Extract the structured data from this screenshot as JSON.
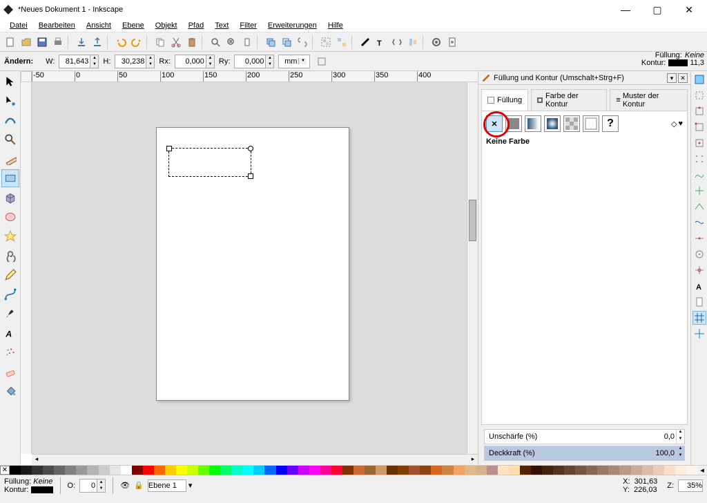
{
  "title": "*Neues Dokument 1 - Inkscape",
  "menus": [
    "Datei",
    "Bearbeiten",
    "Ansicht",
    "Ebene",
    "Objekt",
    "Pfad",
    "Text",
    "Filter",
    "Erweiterungen",
    "Hilfe"
  ],
  "optbar": {
    "label": "Ändern:",
    "W_label": "W:",
    "W": "81,643",
    "H_label": "H:",
    "H": "30,238",
    "Rx_label": "Rx:",
    "Rx": "0,000",
    "Ry_label": "Ry:",
    "Ry": "0,000",
    "unit": "mm"
  },
  "fillkontur_top": {
    "fill_label": "Füllung:",
    "fill_value": "Keine",
    "kontur_label": "Kontur:",
    "kontur_value": "11,3"
  },
  "panel": {
    "title": "Füllung und Kontur (Umschalt+Strg+F)",
    "tab_fill": "Füllung",
    "tab_stroke": "Farbe der Kontur",
    "tab_pattern": "Muster der Kontur",
    "nofill": "Keine Farbe",
    "blur_label": "Unschärfe (%)",
    "blur_value": "0,0",
    "opacity_label": "Deckkraft (%)",
    "opacity_value": "100,0"
  },
  "status": {
    "fill_label": "Füllung:",
    "fill_value": "Keine",
    "kontur_label": "Kontur:",
    "O_label": "O:",
    "O_value": "0",
    "layer_label": "Ebene 1",
    "x_label": "X:",
    "x_value": "301,63",
    "y_label": "Y:",
    "y_value": "226,03",
    "z_label": "Z:",
    "z_value": "35%"
  },
  "ruler_ticks": [
    "-50",
    "0",
    "50",
    "100",
    "150",
    "200",
    "250",
    "300",
    "350",
    "400"
  ],
  "palette": [
    "#000000",
    "#1a1a1a",
    "#333333",
    "#4d4d4d",
    "#666666",
    "#808080",
    "#999999",
    "#b3b3b3",
    "#cccccc",
    "#e6e6e6",
    "#ffffff",
    "#800000",
    "#ff0000",
    "#ff6600",
    "#ffcc00",
    "#ffff00",
    "#ccff00",
    "#66ff00",
    "#00ff00",
    "#00ff66",
    "#00ffcc",
    "#00ffff",
    "#00ccff",
    "#0066ff",
    "#0000ff",
    "#6600ff",
    "#cc00ff",
    "#ff00ff",
    "#ff0099",
    "#ff0033",
    "#803300",
    "#cc6633",
    "#996633",
    "#cc9966",
    "#663300",
    "#804000",
    "#a0522d",
    "#8b4513",
    "#d2691e",
    "#cd853f",
    "#f4a460",
    "#deb887",
    "#d2b48c",
    "#bc8f8f",
    "#ffe4c4",
    "#ffdead",
    "#552200",
    "#331100",
    "#442211",
    "#553322",
    "#664433",
    "#775544",
    "#886655",
    "#997766",
    "#aa8877",
    "#bb9988",
    "#ccaa99",
    "#ddbbaa",
    "#eeccbb",
    "#ffddcc",
    "#ffeedd",
    "#fff5ee"
  ]
}
